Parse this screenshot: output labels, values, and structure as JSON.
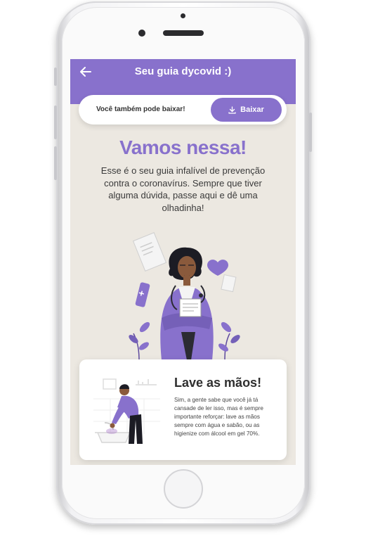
{
  "header": {
    "title": "Seu guia dycovid :)",
    "back_icon": "arrow-left-icon"
  },
  "download": {
    "prompt": "Você também pode baixar!",
    "button_label": "Baixar",
    "button_icon": "download-icon"
  },
  "hero": {
    "heading": "Vamos nessa!",
    "intro": "Esse é o seu guia infalível de prevenção contra o coronavírus. Sempre que tiver alguma dúvida, passe aqui e dê uma olhadinha!"
  },
  "card": {
    "title": "Lave as mãos!",
    "text": "Sim, a gente sabe que você já tá cansade de ler isso, mas é sempre importante reforçar: lave as mãos sempre com água e sabão, ou as higienize com álcool em gel 70%."
  },
  "colors": {
    "accent": "#8871cc",
    "background": "#ece8e1",
    "text": "#3a3a3a"
  }
}
